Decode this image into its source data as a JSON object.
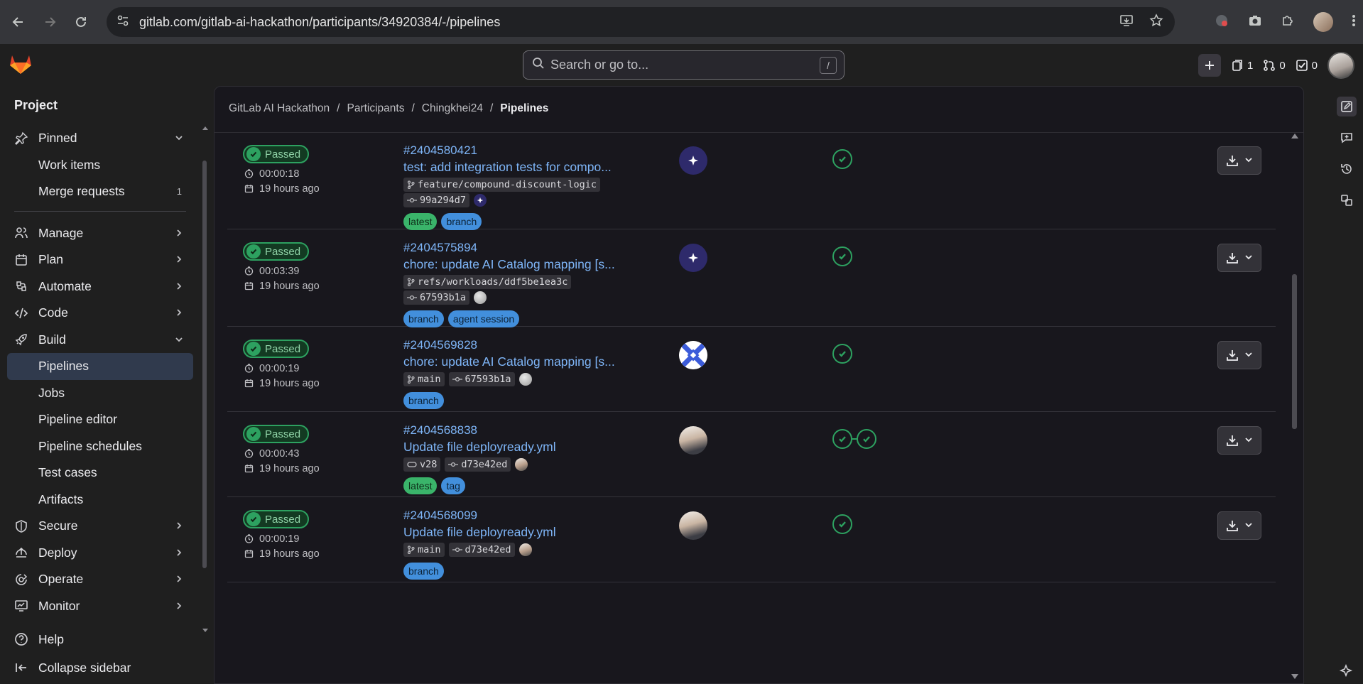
{
  "browser": {
    "url": "gitlab.com/gitlab-ai-hackathon/participants/34920384/-/pipelines"
  },
  "topbar": {
    "search_placeholder": "Search or go to...",
    "search_shortcut": "/",
    "issues_count": "1",
    "mr_count": "0",
    "todos_count": "0"
  },
  "sidebar": {
    "title": "Project",
    "items": [
      {
        "label": "Pinned",
        "icon": "pin-icon",
        "chev": "down"
      },
      {
        "label": "Work items",
        "sub": true
      },
      {
        "label": "Merge requests",
        "sub": true,
        "count": "1"
      },
      {
        "label": "Manage",
        "icon": "users-icon",
        "chev": "right"
      },
      {
        "label": "Plan",
        "icon": "calendar-icon",
        "chev": "right"
      },
      {
        "label": "Automate",
        "icon": "automate-icon",
        "chev": "right"
      },
      {
        "label": "Code",
        "icon": "code-icon",
        "chev": "right"
      },
      {
        "label": "Build",
        "icon": "rocket-icon",
        "chev": "down"
      },
      {
        "label": "Pipelines",
        "sub": true,
        "active": true
      },
      {
        "label": "Jobs",
        "sub": true
      },
      {
        "label": "Pipeline editor",
        "sub": true
      },
      {
        "label": "Pipeline schedules",
        "sub": true
      },
      {
        "label": "Test cases",
        "sub": true
      },
      {
        "label": "Artifacts",
        "sub": true
      },
      {
        "label": "Secure",
        "icon": "shield-icon",
        "chev": "right"
      },
      {
        "label": "Deploy",
        "icon": "deploy-icon",
        "chev": "right"
      },
      {
        "label": "Operate",
        "icon": "operate-icon",
        "chev": "right"
      },
      {
        "label": "Monitor",
        "icon": "monitor-icon",
        "chev": "right"
      }
    ],
    "help": "Help",
    "collapse": "Collapse sidebar"
  },
  "breadcrumb": [
    "GitLab AI Hackathon",
    "Participants",
    "Chingkhei24",
    "Pipelines"
  ],
  "pipelines": [
    {
      "status": "Passed",
      "duration": "00:00:18",
      "finished": "19 hours ago",
      "id": "#2404580421",
      "title": "test: add integration tests for compo...",
      "refs": [
        {
          "kind": "branch",
          "text": "feature/compound-discount-logic"
        }
      ],
      "commit": "99a294d7",
      "commit_avatar": "duo",
      "commit_on_second_line": true,
      "labels": [
        "latest",
        "branch"
      ],
      "trigger": "duo",
      "stages": 1
    },
    {
      "status": "Passed",
      "duration": "00:03:39",
      "finished": "19 hours ago",
      "id": "#2404575894",
      "title": "chore: update AI Catalog mapping [s...",
      "refs": [
        {
          "kind": "branch",
          "text": "refs/workloads/ddf5be1ea3c"
        }
      ],
      "commit": "67593b1a",
      "commit_avatar": "grey",
      "commit_on_second_line": true,
      "labels": [
        "branch",
        "agent session"
      ],
      "trigger": "duo",
      "stages": 1
    },
    {
      "status": "Passed",
      "duration": "00:00:19",
      "finished": "19 hours ago",
      "id": "#2404569828",
      "title": "chore: update AI Catalog mapping [s...",
      "refs": [
        {
          "kind": "branch",
          "text": "main"
        }
      ],
      "commit": "67593b1a",
      "commit_avatar": "grey",
      "commit_on_second_line": false,
      "labels": [
        "branch"
      ],
      "trigger": "pattern",
      "stages": 1
    },
    {
      "status": "Passed",
      "duration": "00:00:43",
      "finished": "19 hours ago",
      "id": "#2404568838",
      "title": "Update file deployready.yml",
      "refs": [
        {
          "kind": "tag",
          "text": "v28"
        }
      ],
      "commit": "d73e42ed",
      "commit_avatar": "user",
      "commit_on_second_line": false,
      "labels": [
        "latest",
        "tag"
      ],
      "trigger": "user",
      "stages": 2
    },
    {
      "status": "Passed",
      "duration": "00:00:19",
      "finished": "19 hours ago",
      "id": "#2404568099",
      "title": "Update file deployready.yml",
      "refs": [
        {
          "kind": "branch",
          "text": "main"
        }
      ],
      "commit": "d73e42ed",
      "commit_avatar": "user",
      "commit_on_second_line": false,
      "labels": [
        "branch"
      ],
      "trigger": "user",
      "stages": 1
    }
  ],
  "colors": {
    "passed": "#2da160",
    "link": "#7eb5f7",
    "label_latest": "#3ab46a",
    "label_branch": "#428fdc"
  }
}
